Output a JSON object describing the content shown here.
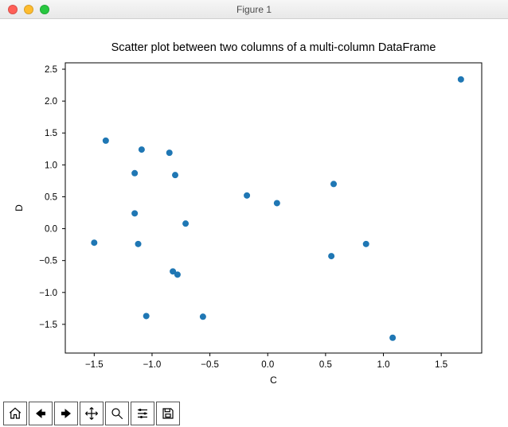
{
  "window": {
    "title": "Figure 1"
  },
  "toolbar": {
    "home": "Home",
    "back": "Back",
    "forward": "Forward",
    "pan": "Pan",
    "zoom": "Zoom",
    "configure": "Configure",
    "save": "Save"
  },
  "chart_data": {
    "type": "scatter",
    "title": "Scatter plot between two columns of a multi-column DataFrame",
    "xlabel": "C",
    "ylabel": "D",
    "xlim": [
      -1.75,
      1.85
    ],
    "ylim": [
      -1.95,
      2.6
    ],
    "xticks": [
      -1.5,
      -1.0,
      -0.5,
      0.0,
      0.5,
      1.0,
      1.5
    ],
    "yticks": [
      -1.5,
      -1.0,
      -0.5,
      0.0,
      0.5,
      1.0,
      1.5,
      2.0,
      2.5
    ],
    "xticklabels": [
      "−1.5",
      "−1.0",
      "−0.5",
      "0.0",
      "0.5",
      "1.0",
      "1.5"
    ],
    "yticklabels": [
      "−1.5",
      "−1.0",
      "−0.5",
      "0.0",
      "0.5",
      "1.0",
      "1.5",
      "2.0",
      "2.5"
    ],
    "points": [
      {
        "x": 1.67,
        "y": 2.34
      },
      {
        "x": -1.4,
        "y": 1.38
      },
      {
        "x": -1.09,
        "y": 1.24
      },
      {
        "x": -0.85,
        "y": 1.19
      },
      {
        "x": -1.15,
        "y": 0.87
      },
      {
        "x": -0.8,
        "y": 0.84
      },
      {
        "x": 0.57,
        "y": 0.7
      },
      {
        "x": -0.18,
        "y": 0.52
      },
      {
        "x": 0.08,
        "y": 0.4
      },
      {
        "x": -1.15,
        "y": 0.24
      },
      {
        "x": -0.71,
        "y": 0.08
      },
      {
        "x": -1.5,
        "y": -0.22
      },
      {
        "x": -1.12,
        "y": -0.24
      },
      {
        "x": 0.85,
        "y": -0.24
      },
      {
        "x": 0.55,
        "y": -0.43
      },
      {
        "x": -0.82,
        "y": -0.67
      },
      {
        "x": -0.78,
        "y": -0.72
      },
      {
        "x": -1.05,
        "y": -1.37
      },
      {
        "x": -0.56,
        "y": -1.38
      },
      {
        "x": 1.08,
        "y": -1.71
      }
    ]
  }
}
